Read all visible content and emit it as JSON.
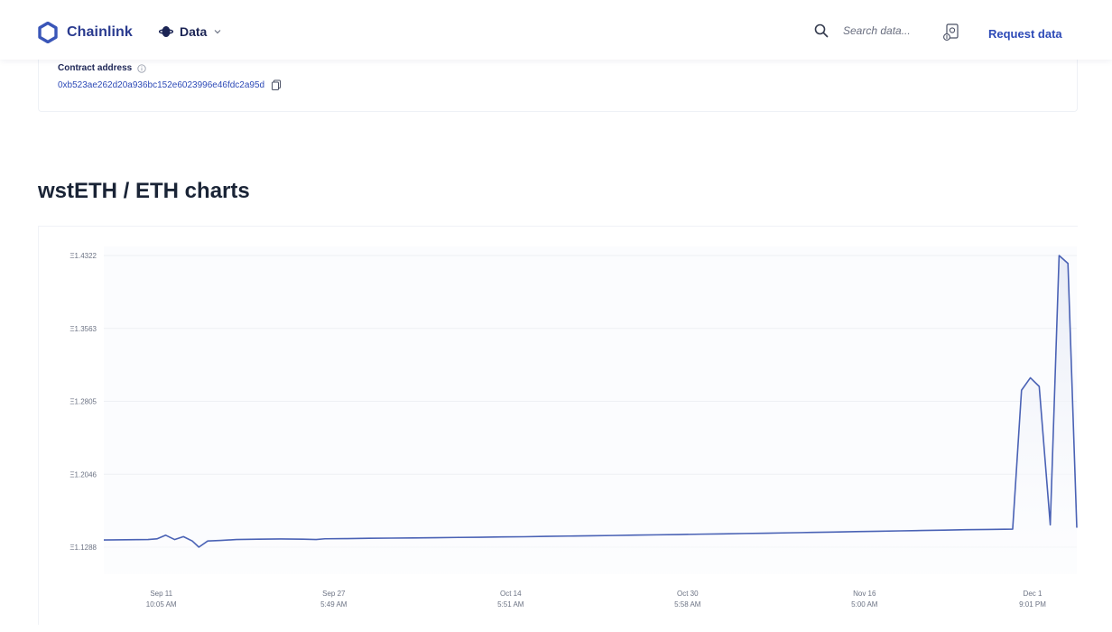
{
  "header": {
    "brand": "Chainlink",
    "data_menu": "Data",
    "search_placeholder": "Search data...",
    "request_label": "Request data"
  },
  "contract": {
    "label": "Contract address",
    "address": "0xb523ae262d20a936bc152e6023996e46fdc2a95d"
  },
  "page_title": "wstETH / ETH charts",
  "colors": {
    "accent": "#3a56b8",
    "line": "#4a62b5",
    "fill": "#e7ebf6",
    "grid": "#eef0f4"
  },
  "chart_data": {
    "type": "area",
    "ylim": [
      1.1288,
      1.4322
    ],
    "y_ticks": [
      "Ξ1.4322",
      "Ξ1.3563",
      "Ξ1.2805",
      "Ξ1.2046",
      "Ξ1.1288"
    ],
    "y_tick_values": [
      1.4322,
      1.3563,
      1.2805,
      1.2046,
      1.1288
    ],
    "x_ticks": [
      {
        "date": "Sep 11",
        "time": "10:05 AM"
      },
      {
        "date": "Sep 27",
        "time": "5:49 AM"
      },
      {
        "date": "Oct 14",
        "time": "5:51 AM"
      },
      {
        "date": "Oct 30",
        "time": "5:58 AM"
      },
      {
        "date": "Nov 16",
        "time": "5:00 AM"
      },
      {
        "date": "Dec 1",
        "time": "9:01 PM"
      }
    ],
    "x_tick_index": [
      2.6,
      10.4,
      18.4,
      26.4,
      34.4,
      42.0
    ],
    "series": [
      {
        "points": [
          [
            0,
            1.1363
          ],
          [
            1,
            1.1365
          ],
          [
            2,
            1.1367
          ],
          [
            2.4,
            1.1374
          ],
          [
            2.8,
            1.1412
          ],
          [
            3.2,
            1.1367
          ],
          [
            3.6,
            1.1397
          ],
          [
            4.0,
            1.1352
          ],
          [
            4.3,
            1.1288
          ],
          [
            4.7,
            1.1352
          ],
          [
            5.3,
            1.1358
          ],
          [
            6,
            1.1367
          ],
          [
            7,
            1.1371
          ],
          [
            8,
            1.1373
          ],
          [
            9,
            1.1371
          ],
          [
            9.6,
            1.1367
          ],
          [
            10,
            1.1375
          ],
          [
            11,
            1.1377
          ],
          [
            12,
            1.138
          ],
          [
            13,
            1.1382
          ],
          [
            14,
            1.1384
          ],
          [
            15,
            1.1386
          ],
          [
            16,
            1.1389
          ],
          [
            17,
            1.1391
          ],
          [
            18,
            1.1394
          ],
          [
            19,
            1.1396
          ],
          [
            20,
            1.14
          ],
          [
            21,
            1.1403
          ],
          [
            22,
            1.1406
          ],
          [
            23,
            1.1409
          ],
          [
            24,
            1.1413
          ],
          [
            25,
            1.1416
          ],
          [
            26,
            1.1419
          ],
          [
            27,
            1.1423
          ],
          [
            28,
            1.1426
          ],
          [
            29,
            1.143
          ],
          [
            30,
            1.1433
          ],
          [
            31,
            1.1437
          ],
          [
            32,
            1.1441
          ],
          [
            33,
            1.1445
          ],
          [
            34,
            1.1449
          ],
          [
            35,
            1.1453
          ],
          [
            36,
            1.1457
          ],
          [
            37,
            1.1461
          ],
          [
            38,
            1.1465
          ],
          [
            39,
            1.1469
          ],
          [
            40,
            1.1472
          ],
          [
            41.1,
            1.1475
          ],
          [
            41.5,
            1.292
          ],
          [
            41.9,
            1.305
          ],
          [
            42.3,
            1.296
          ],
          [
            42.8,
            1.152
          ],
          [
            43.2,
            1.4322
          ],
          [
            43.6,
            1.424
          ],
          [
            44.0,
            1.149
          ]
        ]
      }
    ]
  }
}
